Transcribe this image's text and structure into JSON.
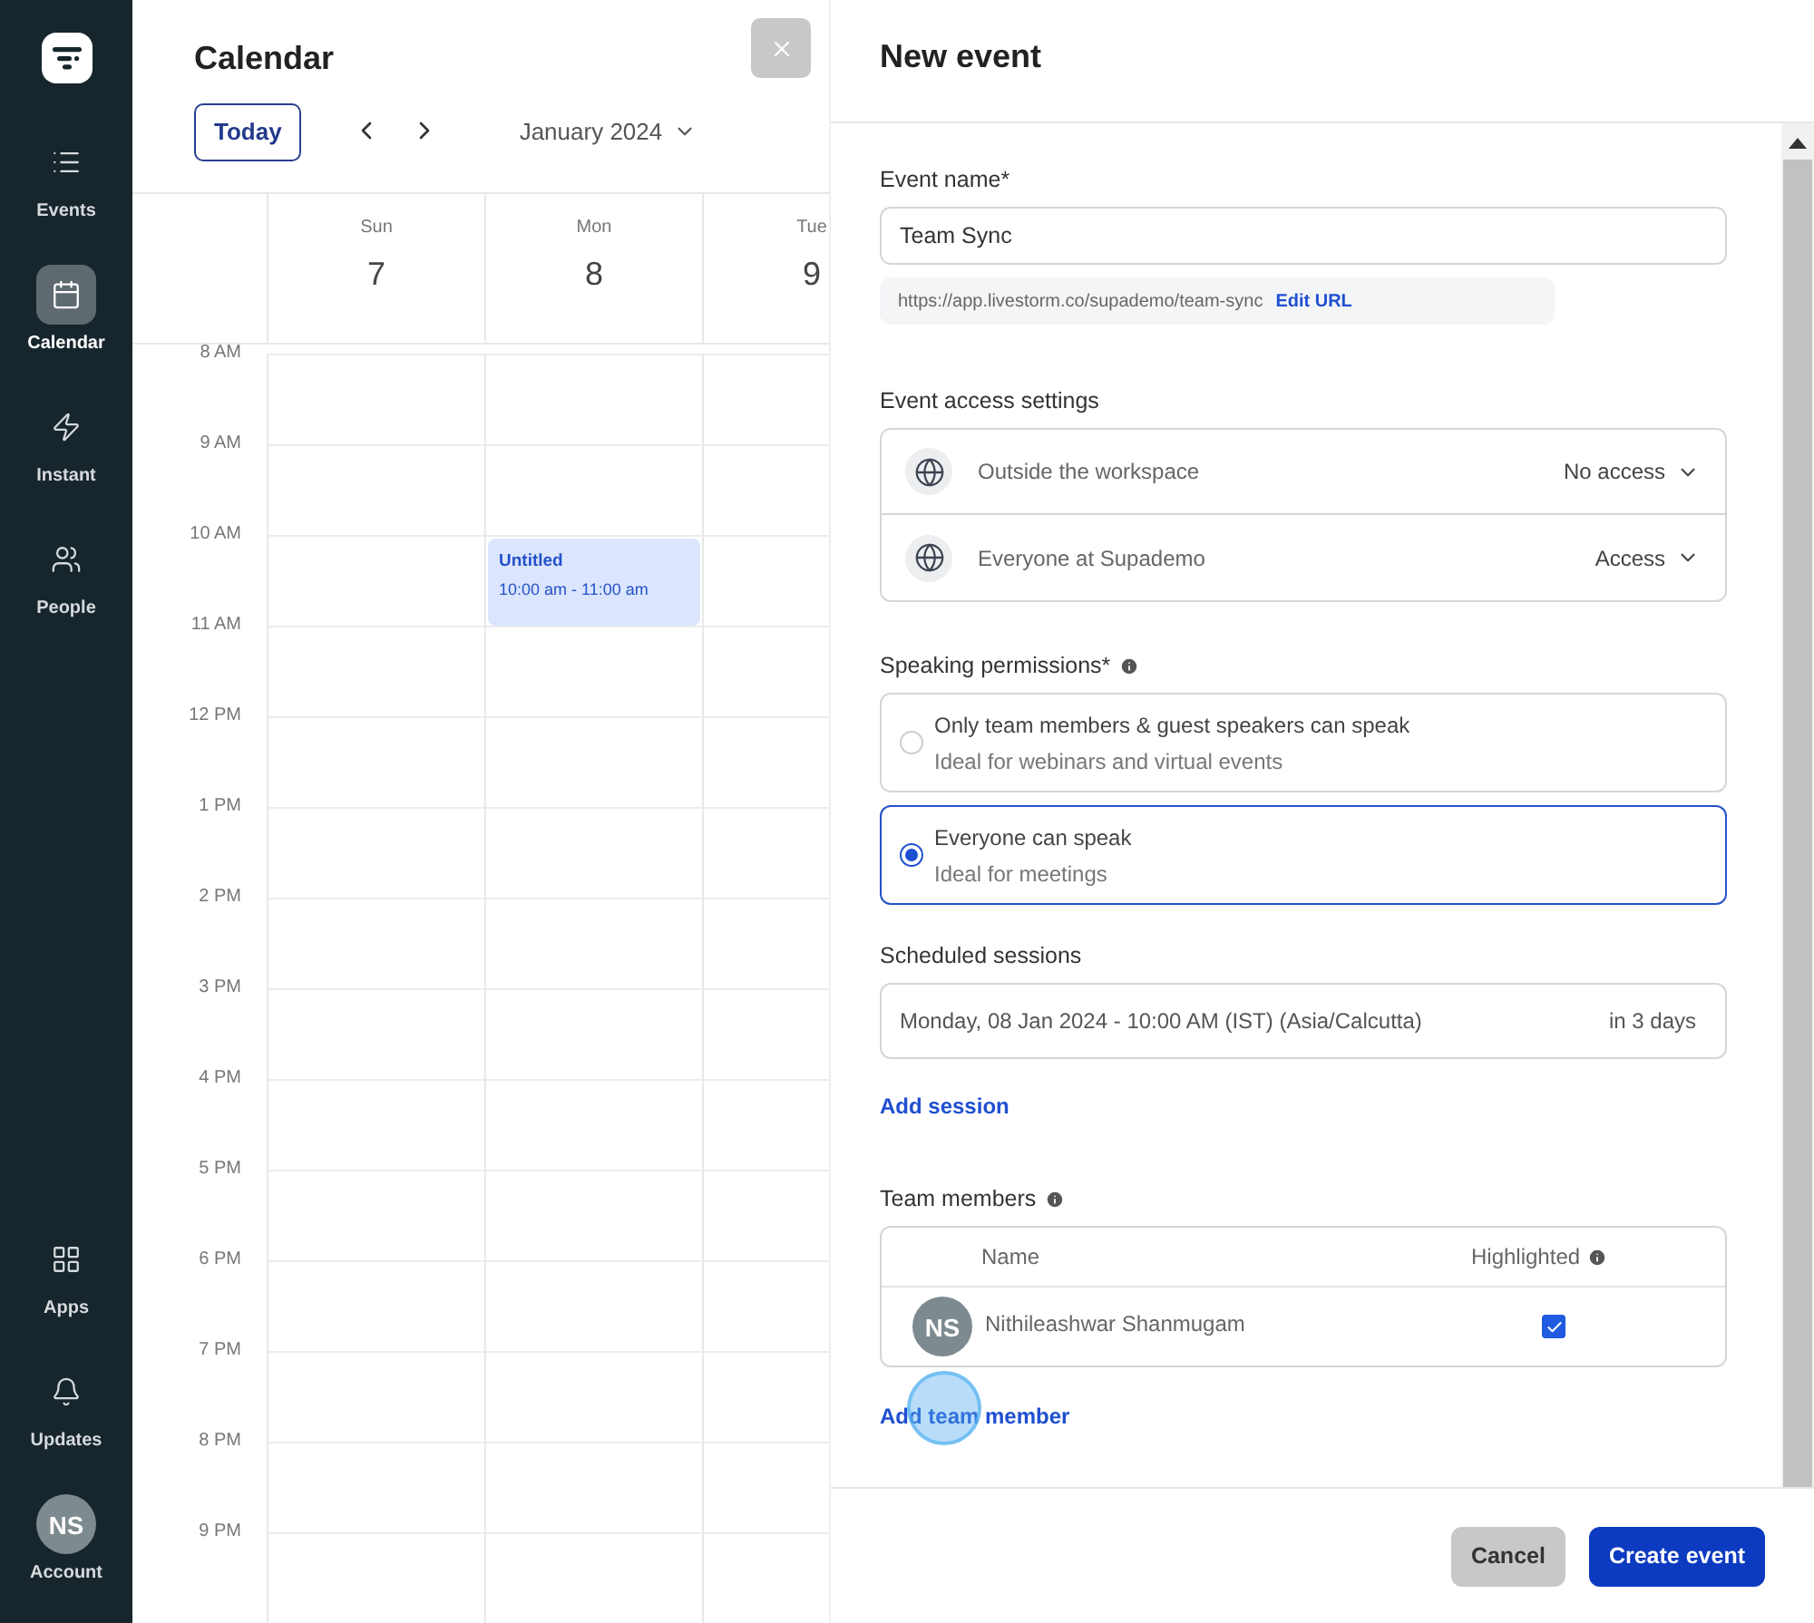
{
  "sidebar": {
    "items": [
      {
        "label": "Events",
        "selected": false
      },
      {
        "label": "Calendar",
        "selected": true
      },
      {
        "label": "Instant",
        "selected": false
      },
      {
        "label": "People",
        "selected": false
      }
    ],
    "bottom_items": [
      {
        "label": "Apps"
      },
      {
        "label": "Updates"
      }
    ],
    "account": {
      "initials": "NS",
      "label": "Account"
    }
  },
  "calendar": {
    "title": "Calendar",
    "today_button": "Today",
    "month": "January 2024",
    "days": [
      {
        "weekday": "Sun",
        "date": "7"
      },
      {
        "weekday": "Mon",
        "date": "8"
      },
      {
        "weekday": "Tue",
        "date": "9"
      }
    ],
    "hours": [
      {
        "label": "8 AM"
      },
      {
        "label": "9 AM"
      },
      {
        "label": "10 AM",
        "cells": [
          null,
          {
            "title": "Untitled",
            "time": "10:00 am - 11:00 am"
          },
          null
        ]
      },
      {
        "label": "11 AM"
      },
      {
        "label": "12 PM"
      },
      {
        "label": "1 PM"
      },
      {
        "label": "2 PM"
      },
      {
        "label": "3 PM"
      },
      {
        "label": "4 PM"
      },
      {
        "label": "5 PM"
      },
      {
        "label": "6 PM"
      },
      {
        "label": "7 PM"
      },
      {
        "label": "8 PM"
      },
      {
        "label": "9 PM"
      }
    ]
  },
  "new_event": {
    "title": "New event",
    "event_name": {
      "label": "Event name*",
      "value": "Team Sync"
    },
    "url": {
      "text": "https://app.livestorm.co/supademo/team-sync",
      "link": "Edit URL"
    },
    "access": {
      "label": "Event access settings",
      "rows": [
        {
          "name": "Outside the workspace",
          "value": "No access"
        },
        {
          "name": "Everyone at Supademo",
          "value": "Access"
        }
      ]
    },
    "speaking": {
      "label": "Speaking permissions*",
      "options": [
        {
          "title": "Only team members & guest speakers can speak",
          "subtitle": "Ideal for webinars and virtual events",
          "selected": false
        },
        {
          "title": "Everyone can speak",
          "subtitle": "Ideal for meetings",
          "selected": true
        }
      ]
    },
    "sessions": {
      "label": "Scheduled sessions",
      "items": [
        {
          "text": "Monday, 08 Jan 2024 - 10:00 AM (IST) (Asia/Calcutta)",
          "relative": "in 3 days"
        }
      ],
      "add_link": "Add session"
    },
    "team": {
      "label": "Team members",
      "columns": [
        "Name",
        "Highlighted"
      ],
      "members": [
        {
          "initials": "NS",
          "name": "Nithileashwar Shanmugam",
          "highlighted": true
        }
      ],
      "add_link": "Add team member"
    },
    "buttons": {
      "cancel": "Cancel",
      "create": "Create event"
    }
  }
}
